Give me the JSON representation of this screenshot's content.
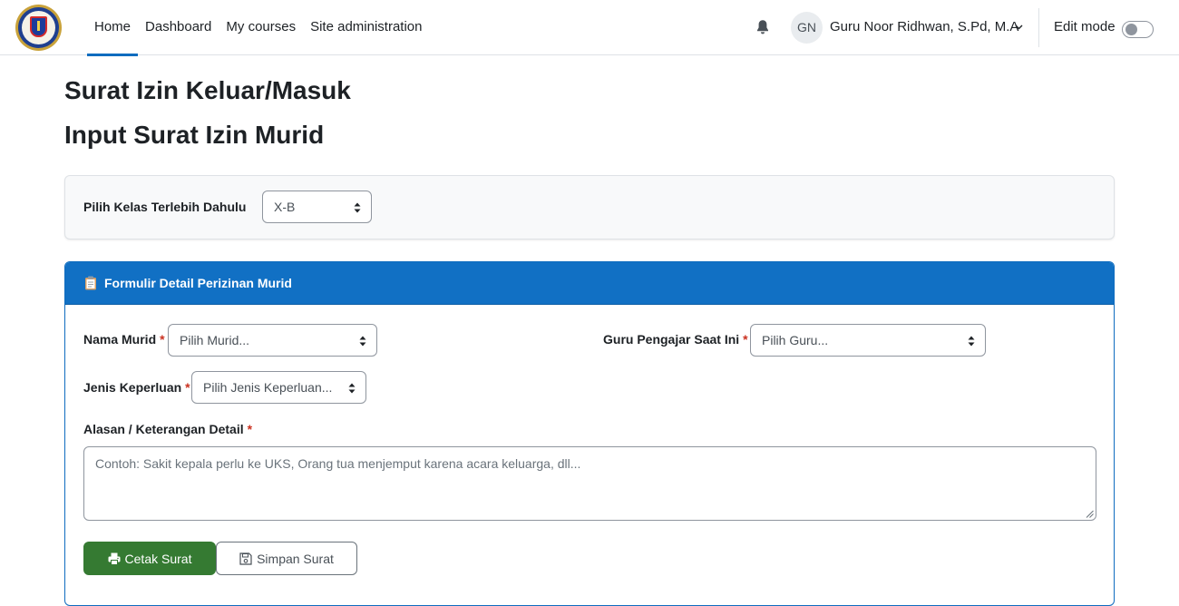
{
  "nav": {
    "links": [
      "Home",
      "Dashboard",
      "My courses",
      "Site administration"
    ],
    "active_link": "Home",
    "user_initials": "GN",
    "user_name": "Guru Noor Ridhwan, S.Pd, M.A",
    "edit_mode_label": "Edit mode",
    "edit_mode_on": false
  },
  "page": {
    "title": "Surat Izin Keluar/Masuk",
    "subtitle": "Input Surat Izin Murid"
  },
  "class_picker": {
    "label": "Pilih Kelas Terlebih Dahulu",
    "selected": "X-B"
  },
  "form": {
    "header_title": "Formulir Detail Perizinan Murid",
    "header_icon": "clipboard-icon",
    "required_marker": "*",
    "student": {
      "label": "Nama Murid",
      "placeholder": "Pilih Murid..."
    },
    "teacher": {
      "label": "Guru Pengajar Saat Ini",
      "placeholder": "Pilih Guru..."
    },
    "purpose": {
      "label": "Jenis Keperluan",
      "placeholder": "Pilih Jenis Keperluan..."
    },
    "reason": {
      "label": "Alasan / Keterangan Detail",
      "placeholder": "Contoh: Sakit kepala perlu ke UKS, Orang tua menjemput karena acara keluarga, dll..."
    },
    "buttons": {
      "print_label": "Cetak Surat",
      "print_icon": "printer-icon",
      "save_label": "Simpan Surat",
      "save_icon": "floppy-disk-icon"
    }
  },
  "colors": {
    "primary": "#0f6cbf",
    "form_header": "#1170c4",
    "print_button": "#357a32",
    "required": "#ca3120"
  }
}
